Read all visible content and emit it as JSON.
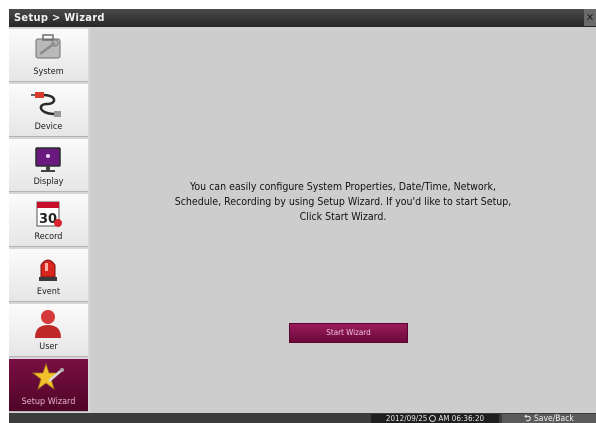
{
  "window": {
    "title": "Setup > Wizard",
    "close_icon": "close-icon"
  },
  "sidebar": {
    "items": [
      {
        "label": "System",
        "icon": "toolbox-icon"
      },
      {
        "label": "Device",
        "icon": "cable-plug-icon"
      },
      {
        "label": "Display",
        "icon": "monitor-icon"
      },
      {
        "label": "Record",
        "icon": "calendar-record-icon"
      },
      {
        "label": "Event",
        "icon": "siren-icon"
      },
      {
        "label": "User",
        "icon": "user-icon"
      },
      {
        "label": "Setup Wizard",
        "icon": "wizard-star-icon",
        "active": true
      }
    ]
  },
  "main": {
    "intro_text": "You can easily configure System Properties, Date/Time, Network, Schedule, Recording by using Setup Wizard. If you'd like to start Setup, Click Start Wizard.",
    "start_button_label": "Start Wizard"
  },
  "statusbar": {
    "date": "2012/09/25",
    "time": "AM 06:36:20",
    "save_back_label": "Save/Back"
  },
  "colors": {
    "accent": "#7a0f43",
    "content_bg": "#cdcdcd",
    "titlebar": "#2f2f2f"
  }
}
